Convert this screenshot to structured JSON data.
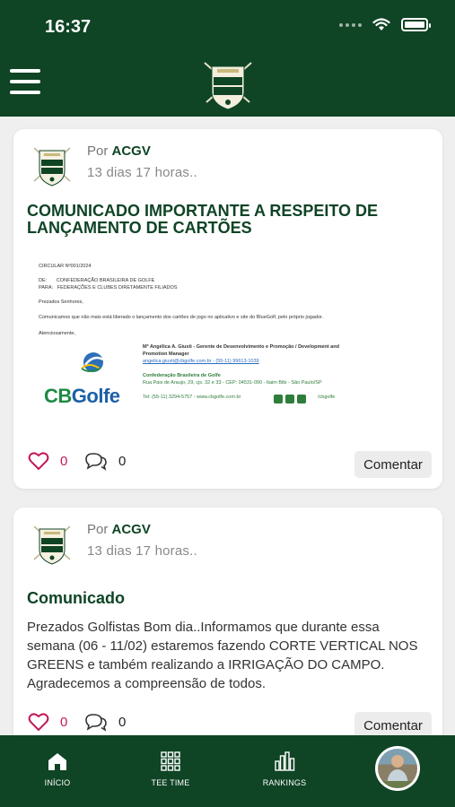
{
  "status_bar": {
    "time": "16:37"
  },
  "posts": [
    {
      "author_prefix": "Por",
      "author": "ACGV",
      "time": "13 dias 17 horas..",
      "title": "COMUNICADO IMPORTANTE A RESPEITO DE LANÇAMENTO DE CARTÕES",
      "document": {
        "ref": "CIRCULAR Nº001/2024",
        "from_label": "DE:",
        "from": "CONFEDERAÇÃO BRASILEIRA DE GOLFE",
        "to_label": "PARA:",
        "to": "FEDERAÇÕES E CLUBES DIRETAMENTE FILIADOS",
        "greeting": "Prezados Senhores,",
        "body": "Comunicamos que não mais está liberado o lançamento dos cartões de jogo no aplicativo e site do BlueGolf, pelo próprio jogador.",
        "closing": "Atenciosamente,",
        "sig_name": "Mª Angélica A. Giusti - Gerente de Desenvolvimento e Promoção / Development and",
        "sig_role": "Promotion Manager",
        "sig_contact": "angelica.giusti@cbgolfe.com.br - (55-11) 99613-1039",
        "sig_org": "Confederação Brasileira de Golfe",
        "sig_address": "Rua Pais de Araujo, 29, cjs. 32 e 33 - CEP: 04531-090 - Itaim Bibi - São Paulo/SP",
        "sig_tel": "Tel: (55-11) 3294-5757 - www.cbgolfe.com.br",
        "sig_handle": "/cbgolfe",
        "logo_text_a": "CB",
        "logo_text_b": "Golfe"
      },
      "likes": "0",
      "comments": "0",
      "comment_label": "Comentar"
    },
    {
      "author_prefix": "Por",
      "author": "ACGV",
      "time": "13 dias 17 horas..",
      "title": "Comunicado",
      "body": "Prezados Golfistas Bom dia..Informamos que durante essa semana (06 - 11/02) estaremos fazendo CORTE VERTICAL NOS GREENS e também realizando a IRRIGAÇÃO DO CAMPO. Agradecemos a compreensão de todos.",
      "likes": "0",
      "comments": "0",
      "comment_label": "Comentar"
    }
  ],
  "bottom_nav": {
    "items": [
      {
        "label": "INÍCIO",
        "icon": "home-icon"
      },
      {
        "label": "TEE TIME",
        "icon": "grid-icon"
      },
      {
        "label": "RANKINGS",
        "icon": "bar-chart-icon"
      }
    ]
  },
  "colors": {
    "brand_green": "#0f4425",
    "like_pink": "#c2185b",
    "background": "#efefef"
  }
}
